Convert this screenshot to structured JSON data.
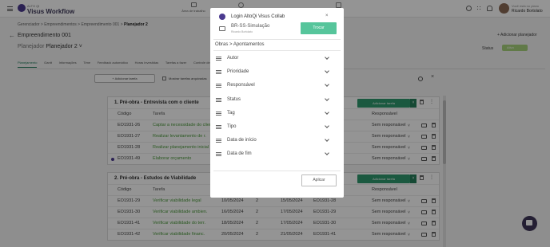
{
  "app": {
    "logo_small": "ALTO QI",
    "logo_big": "Visus Workflow",
    "nav_center": "Área de trabalho"
  },
  "user": {
    "hint": "Você está no plano",
    "name": "Ricardo Bortolato"
  },
  "breadcrumb": [
    "Gerenciador",
    "Empreendimentos",
    "Empreendimento 001",
    "Planejador 2"
  ],
  "breadcrumb_sep": " > ",
  "project_title": "Empreendimento 001",
  "add_planner_label": "+ Adicionar planejador",
  "planner": {
    "label": "Planejador",
    "value": "Planejador 2"
  },
  "status": {
    "label": "Status",
    "value": "Ativo",
    "color": "#a7d37c"
  },
  "tabs": [
    "Planejamento",
    "Gantt",
    "Informações",
    "Time",
    "Feedback automático",
    "Horas investidas",
    "Tarefas a fazer",
    "Controle de alterações"
  ],
  "toolbar": {
    "add_task_label": "+ Adicionar tarefa",
    "show_done_label": "Mostrar tarefas arquivadas"
  },
  "columns": {
    "code": "Código",
    "task": "Tarefa",
    "responsible": "Responsável"
  },
  "sections": [
    {
      "title": "1. Pré-obra - Entrevista com o cliente",
      "add_tasks_label": "Adicionar tarefa",
      "rows": [
        {
          "code": "EO1931-26",
          "task": "Captar a necessidade do cliente",
          "date_start": "",
          "num": "",
          "date_end": "",
          "pred": "",
          "responsible": "Sem responsável"
        },
        {
          "code": "EO1931-27",
          "task": "Realizar levantamento de r.",
          "date_start": "",
          "num": "",
          "date_end": "",
          "pred": "",
          "responsible": "Sem responsável"
        },
        {
          "code": "EO1931-28",
          "task": "Realizar planejamento inicial",
          "date_start": "",
          "num": "",
          "date_end": "",
          "pred": "",
          "responsible": "Sem responsável"
        },
        {
          "code": "EO1931-49",
          "task": "Elaborar orçamento",
          "date_start": "",
          "num": "",
          "date_end": "",
          "pred": "",
          "responsible": "Sem responsável"
        }
      ]
    },
    {
      "title": "2. Pré-obra - Estudos de Viabilidade",
      "add_tasks_label": "Adicionar tarefa",
      "rows": [
        {
          "code": "EO1931-29",
          "task": "Verificar viabilidade legal",
          "date_start": "10/05/2024",
          "num": "2",
          "date_end": "15/05/2024",
          "pred": "EO1931-28",
          "responsible": "Sem responsável"
        },
        {
          "code": "EO1931-30",
          "task": "Verificar viabilidade ambien.",
          "date_start": "16/05/2024",
          "num": "2",
          "date_end": "17/05/2024",
          "pred": "EO1931-29",
          "responsible": "Sem responsável"
        },
        {
          "code": "EO1931-41",
          "task": "Verificar viabilidade do terr.",
          "date_start": "18/05/2024",
          "num": "2",
          "date_end": "17/05/2024",
          "pred": "EO1931-30",
          "responsible": "Sem responsável"
        },
        {
          "code": "EO1931-42",
          "task": "Verificar viabilidade financ.",
          "date_start": "20/05/2024",
          "num": "2",
          "date_end": "21/05/2024",
          "pred": "EO1931-41",
          "responsible": "Sem responsável"
        }
      ]
    }
  ],
  "modal": {
    "login_label": "Login AltoQi Visus Collab",
    "database": "BR-SS-Simulação",
    "user": "Ricardo Bortolato",
    "switch_label": "Trocar",
    "crumb": "Obras > Apontamentos",
    "filters": [
      "Autor",
      "Prioridade",
      "Responsável",
      "Status",
      "Tag",
      "Tipo",
      "Data de início",
      "Data de fim"
    ],
    "apply_label": "Aplicar"
  }
}
